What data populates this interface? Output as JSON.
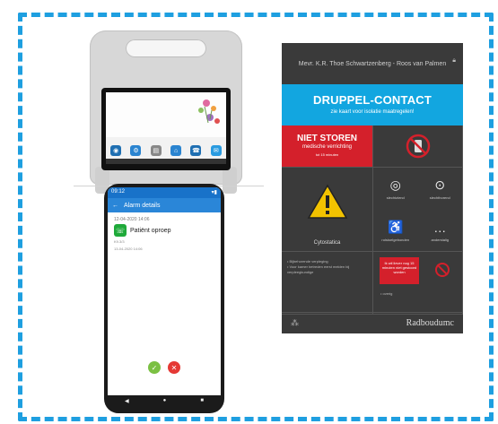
{
  "tablet": {
    "apps": [
      "◉",
      "⚙",
      "▤",
      "⌂",
      "☎",
      "✉"
    ],
    "app_colors": [
      "#1f6fb2",
      "#2a84d0",
      "#888888",
      "#2a84d0",
      "#1f6fb2",
      "#2a9be0"
    ]
  },
  "phone": {
    "status_time": "09:12",
    "status_right": "▾▮",
    "app_title": "Alarm details",
    "alarm_date": "12-04-2020  14:06",
    "alarm_label": "Patiënt oproep",
    "alarm_sub": "K9.3/3",
    "alarm_time": "13-04-2020 14:06",
    "accept_icon": "✓",
    "reject_icon": "✕",
    "nav": [
      "◀",
      "●",
      "■"
    ]
  },
  "card": {
    "patient": "Mevr. K.R. Thoe Schwartzenberg - Roos van Palmen",
    "banner_title": "DRUPPEL-CONTACT",
    "banner_sub": "zie kaart voor isolatie maatregelen!",
    "niet_storen": "NIET STOREN",
    "medische": "medische verrichting",
    "tot": "tot 15 minuten",
    "cytostatica": "Cytostatica",
    "mini": [
      {
        "glyph": "◎",
        "label": "slechtziend"
      },
      {
        "glyph": "⊙",
        "label": "slechthorend"
      },
      {
        "glyph": "♿",
        "label": "rolstoelgebonden"
      },
      {
        "glyph": "…",
        "label": "anderstalig"
      }
    ],
    "info": "• Bijbehorende verpleging\n• Voor kamer betreden eerst melden bij verpleegkundige",
    "warn": "Ik wil liever nog 15 minuten niet gestoord worden",
    "more": "• overig",
    "brand": "Radboudumc",
    "foot_icon": "⁂"
  }
}
